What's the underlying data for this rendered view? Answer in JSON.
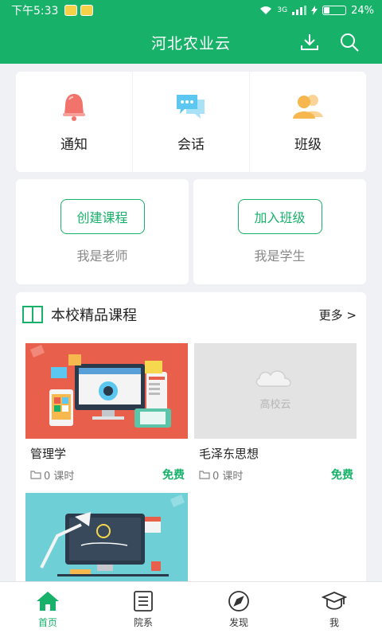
{
  "status_bar": {
    "time": "下午5:33",
    "network": "3G",
    "battery": "24%"
  },
  "header": {
    "title": "河北农业云",
    "download_icon": "download-icon",
    "search_icon": "search-icon"
  },
  "quick_actions": [
    {
      "label": "通知",
      "icon": "bell-icon"
    },
    {
      "label": "会话",
      "icon": "chat-icon"
    },
    {
      "label": "班级",
      "icon": "users-icon"
    }
  ],
  "roles": {
    "teacher": {
      "button": "创建课程",
      "subtitle": "我是老师"
    },
    "student": {
      "button": "加入班级",
      "subtitle": "我是学生"
    }
  },
  "courses_section": {
    "title": "本校精品课程",
    "more": "更多 >",
    "items": [
      {
        "name": "管理学",
        "lessons": "0 课时",
        "price": "免费"
      },
      {
        "name": "毛泽东思想",
        "lessons": "0 课时",
        "price": "免费",
        "placeholder": "高校云"
      },
      {
        "name": "",
        "lessons": "",
        "price": ""
      }
    ]
  },
  "bottom_nav": [
    {
      "label": "首页",
      "icon": "home-icon",
      "active": true
    },
    {
      "label": "院系",
      "icon": "document-icon",
      "active": false
    },
    {
      "label": "发现",
      "icon": "compass-icon",
      "active": false
    },
    {
      "label": "我",
      "icon": "graduation-cap-icon",
      "active": false
    }
  ],
  "colors": {
    "accent": "#17b169",
    "bell": "#f2736c",
    "chat": "#5cc7f0",
    "users": "#f5b74e"
  }
}
